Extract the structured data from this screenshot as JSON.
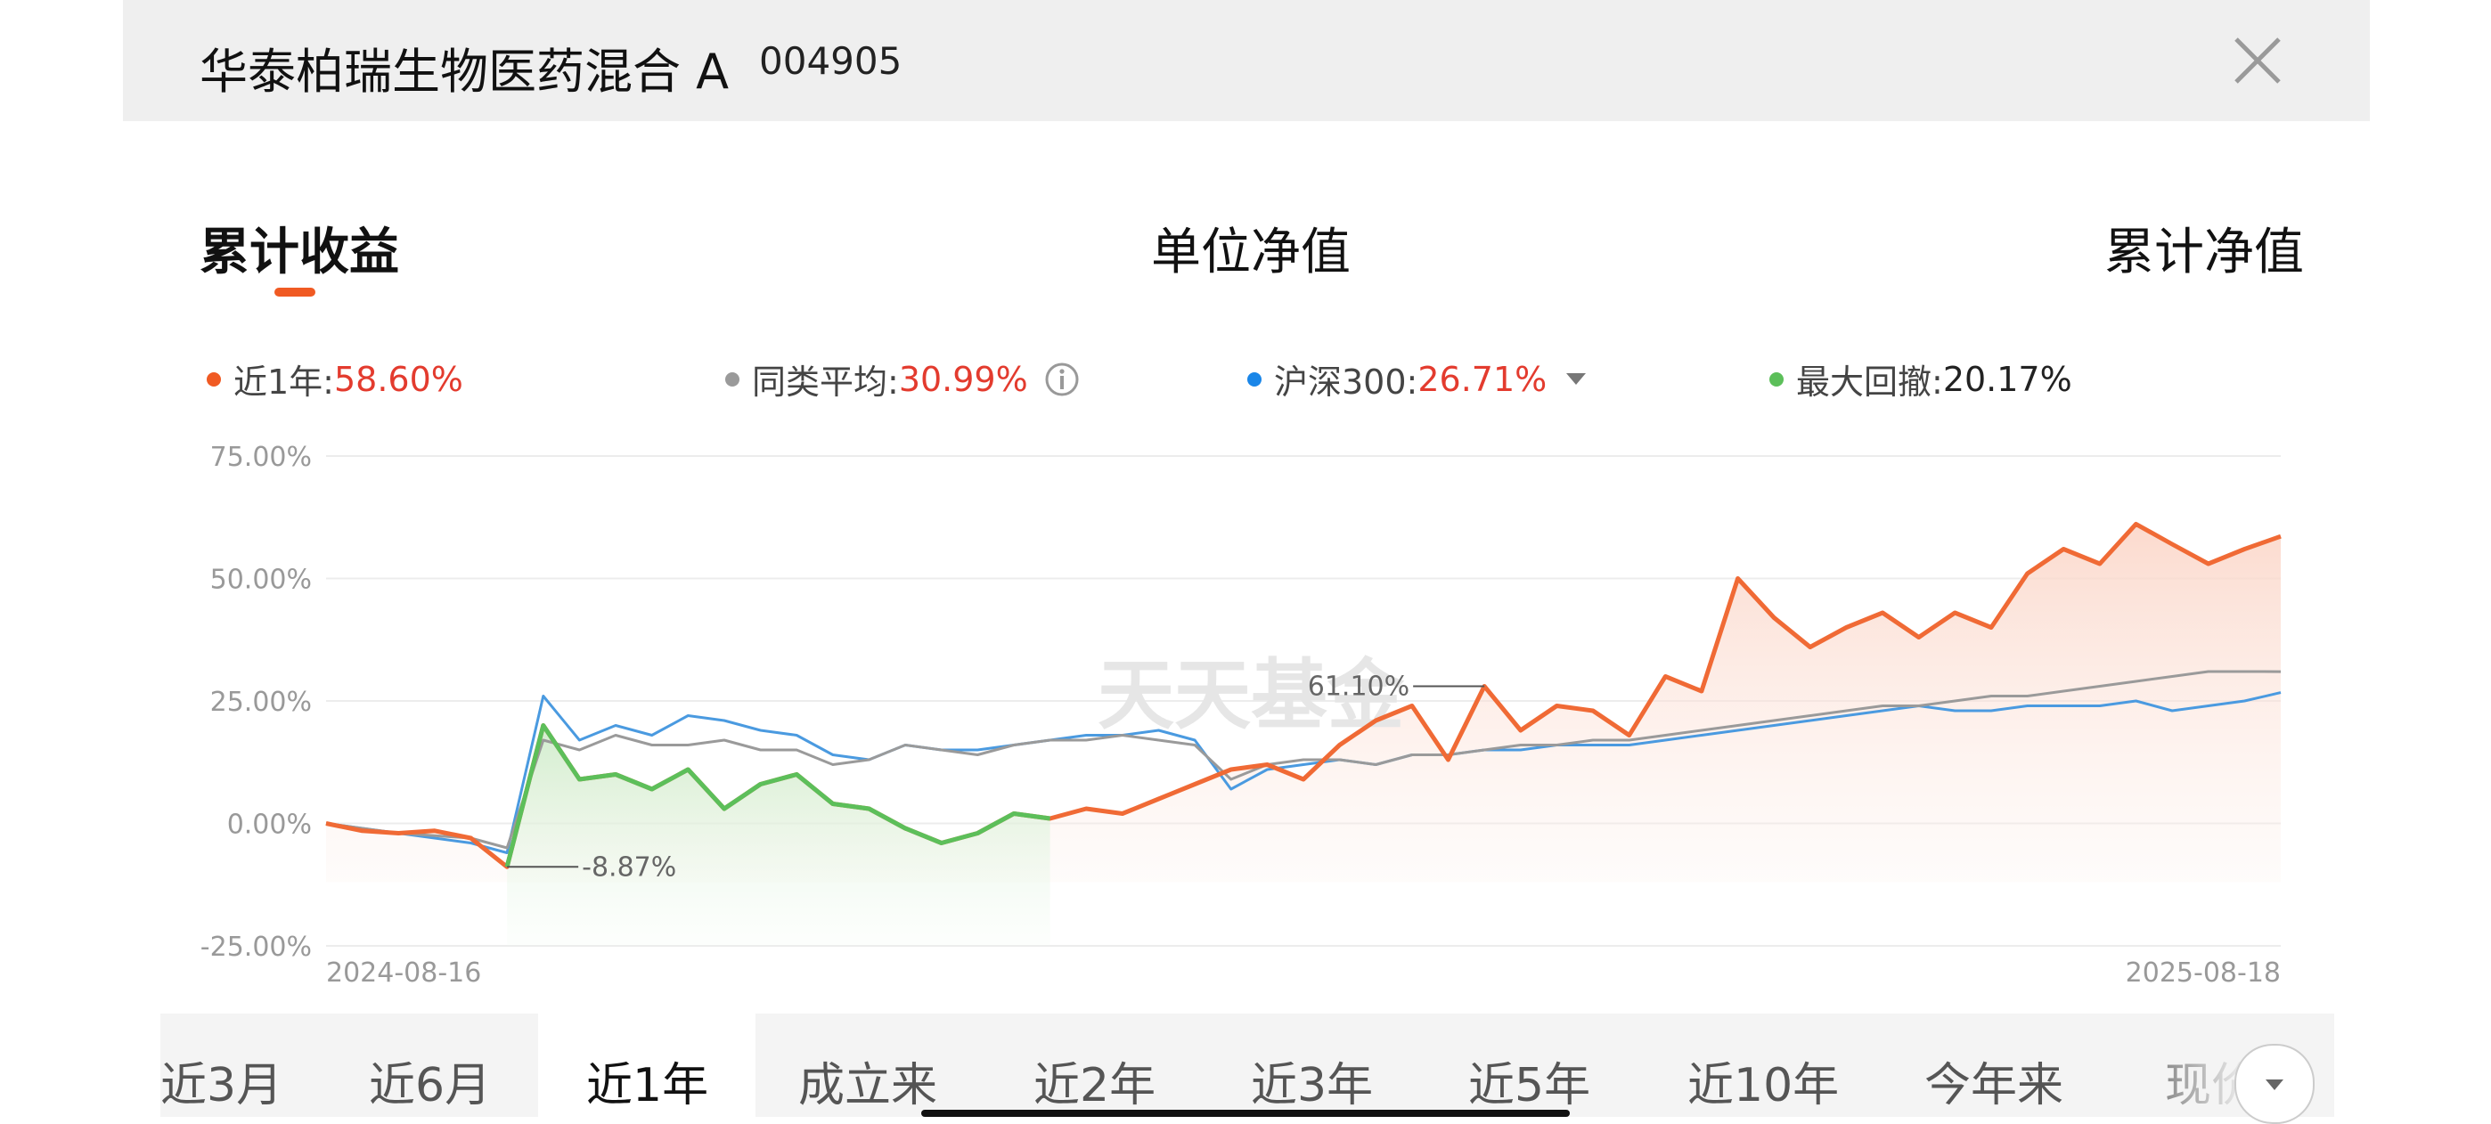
{
  "header": {
    "fund_name": "华泰柏瑞生物医药混合 A",
    "fund_code": "004905"
  },
  "tabs": [
    "累计收益",
    "单位净值",
    "累计净值"
  ],
  "legend": {
    "fund": {
      "label": "近1年:",
      "value": "58.60%"
    },
    "peer": {
      "label": "同类平均:",
      "value": "30.99%"
    },
    "index": {
      "label": "沪深300:",
      "value": "26.71%"
    },
    "drawdown": {
      "label": "最大回撤:",
      "value": "20.17%"
    }
  },
  "watermark": "天天基金",
  "range_tabs": [
    "近3月",
    "近6月",
    "近1年",
    "成立来",
    "近2年",
    "近3年",
    "近5年",
    "近10年",
    "今年来",
    "现价"
  ],
  "colors": {
    "fund": "#f06a35",
    "peer": "#9a9a9a",
    "index": "#4a9ae0",
    "drawdown": "#5cbf5a",
    "accent": "#e33b2e"
  },
  "chart_data": {
    "type": "line",
    "x_start": "2024-08-16",
    "x_end": "2025-08-18",
    "y_ticks": [
      "75.00%",
      "50.00%",
      "25.00%",
      "0.00%",
      "-25.00%"
    ],
    "ylim": [
      -25,
      75
    ],
    "annotations": [
      {
        "text": "61.10%",
        "series": "fund",
        "index": 32
      },
      {
        "text": "-8.87%",
        "series": "fund",
        "index": 5
      }
    ],
    "drawdown_range": [
      5,
      20
    ],
    "series": [
      {
        "key": "fund",
        "values": [
          0,
          -1.5,
          -2,
          -1.5,
          -3,
          -8.87,
          20,
          9,
          10,
          7,
          11,
          3,
          8,
          10,
          4,
          3,
          -1,
          -4,
          -2,
          2,
          1,
          3,
          2,
          5,
          8,
          11,
          12,
          9,
          16,
          21,
          24,
          13,
          28,
          19,
          24,
          23,
          18,
          30,
          27,
          50,
          42,
          36,
          40,
          43,
          38,
          43,
          40,
          51,
          56,
          53,
          61.1,
          57,
          53,
          56,
          58.6
        ]
      },
      {
        "key": "peer",
        "values": [
          0,
          -1,
          -2,
          -2.5,
          -3,
          -5,
          17,
          15,
          18,
          16,
          16,
          17,
          15,
          15,
          12,
          13,
          16,
          15,
          14,
          16,
          17,
          17,
          18,
          17,
          16,
          9,
          12,
          13,
          13,
          12,
          14,
          14,
          15,
          16,
          16,
          17,
          17,
          18,
          19,
          20,
          21,
          22,
          23,
          24,
          24,
          25,
          26,
          26,
          27,
          28,
          29,
          30,
          31,
          31,
          30.99
        ]
      },
      {
        "key": "index",
        "values": [
          0,
          -1,
          -2,
          -3,
          -4,
          -6,
          26,
          17,
          20,
          18,
          22,
          21,
          19,
          18,
          14,
          13,
          16,
          15,
          15,
          16,
          17,
          18,
          18,
          19,
          17,
          7,
          11,
          12,
          13,
          12,
          14,
          14,
          15,
          15,
          16,
          16,
          16,
          17,
          18,
          19,
          20,
          21,
          22,
          23,
          24,
          23,
          23,
          24,
          24,
          24,
          25,
          23,
          24,
          25,
          26.71
        ]
      }
    ]
  }
}
